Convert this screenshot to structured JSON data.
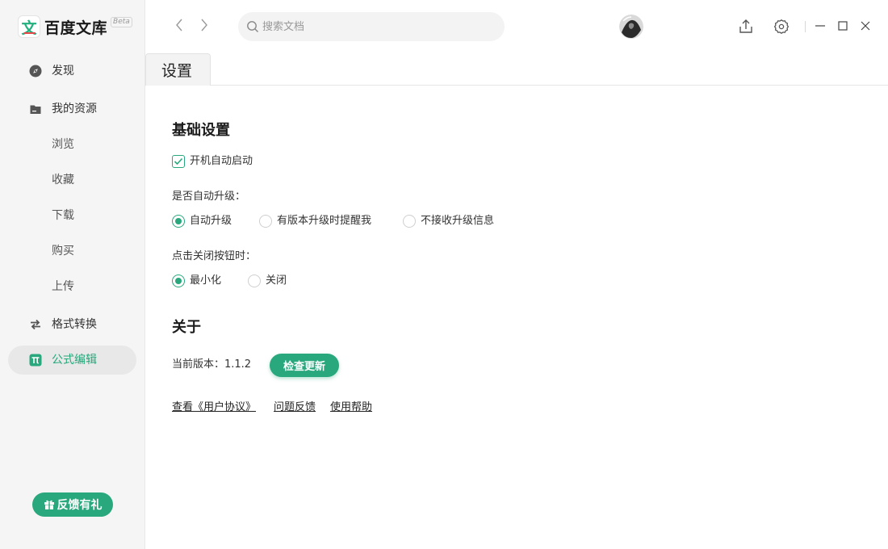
{
  "app": {
    "name": "百度文库",
    "beta": "Beta",
    "logo_char": "文"
  },
  "sidebar": {
    "items": [
      {
        "label": "发现",
        "icon": "compass-icon"
      },
      {
        "label": "我的资源",
        "icon": "folder-icon"
      },
      {
        "label": "格式转换",
        "icon": "swap-arrows-icon"
      },
      {
        "label": "公式编辑",
        "icon": "pi-icon",
        "active": true
      }
    ],
    "sub_items": [
      "浏览",
      "收藏",
      "下载",
      "购买",
      "上传"
    ],
    "feedback_label": "反馈有礼"
  },
  "topbar": {
    "search_placeholder": "搜索文档"
  },
  "tab": {
    "label": "设置"
  },
  "settings": {
    "basic_title": "基础设置",
    "autostart": {
      "label": "开机自动启动",
      "checked": true
    },
    "upgrade_question": "是否自动升级：",
    "upgrade_options": [
      "自动升级",
      "有版本升级时提醒我",
      "不接收升级信息"
    ],
    "upgrade_selected": 0,
    "close_question": "点击关闭按钮时：",
    "close_options": [
      "最小化",
      "关闭"
    ],
    "close_selected": 0
  },
  "about": {
    "title": "关于",
    "version_text": "当前版本：1.1.2",
    "check_update_label": "检查更新",
    "links": [
      "查看《用户协议》",
      "问题反馈",
      "使用帮助"
    ]
  },
  "colors": {
    "accent": "#2aa87d",
    "sidebar_bg": "#f5f5f5"
  }
}
